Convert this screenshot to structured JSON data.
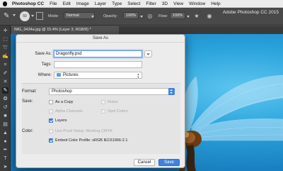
{
  "menubar": {
    "app_name": "Photoshop CC",
    "items": [
      "File",
      "Edit",
      "Image",
      "Layer",
      "Type",
      "Select",
      "Filter",
      "3D",
      "View",
      "Window",
      "Help"
    ]
  },
  "options_bar": {
    "size_value": "50",
    "mode_label": "Mode:",
    "mode_value": "Normal",
    "opacity_label": "Opacity:",
    "opacity_value": "100%",
    "flow_label": "Flow:",
    "flow_value": "100%"
  },
  "app_title": "Adobe Photoshop CC 2015",
  "document_tab": "IMG_0434a.jpg @ 15.4% (Layer 3, RGB/8) *",
  "dialog": {
    "title": "Save As",
    "save_as_label": "Save As:",
    "save_as_value": "Dragonfly.psd",
    "tags_label": "Tags:",
    "tags_value": "",
    "where_label": "Where:",
    "where_value": "Pictures",
    "format_label": "Format:",
    "format_value": "Photoshop",
    "save_label": "Save:",
    "options": {
      "as_a_copy": "As a Copy",
      "notes": "Notes",
      "alpha_channels": "Alpha Channels",
      "spot_colors": "Spot Colors",
      "layers": "Layers"
    },
    "color_label": "Color:",
    "use_proof_setup": "Use Proof Setup:  Working CMYK",
    "embed_color_profile": "Embed Color Profile:  sRGB IEC61966-2.1",
    "cancel_button": "Cancel",
    "save_button": "Save"
  },
  "colors": {
    "accent": "#3b84e5",
    "canvas_sky": "#2aa3dc"
  }
}
